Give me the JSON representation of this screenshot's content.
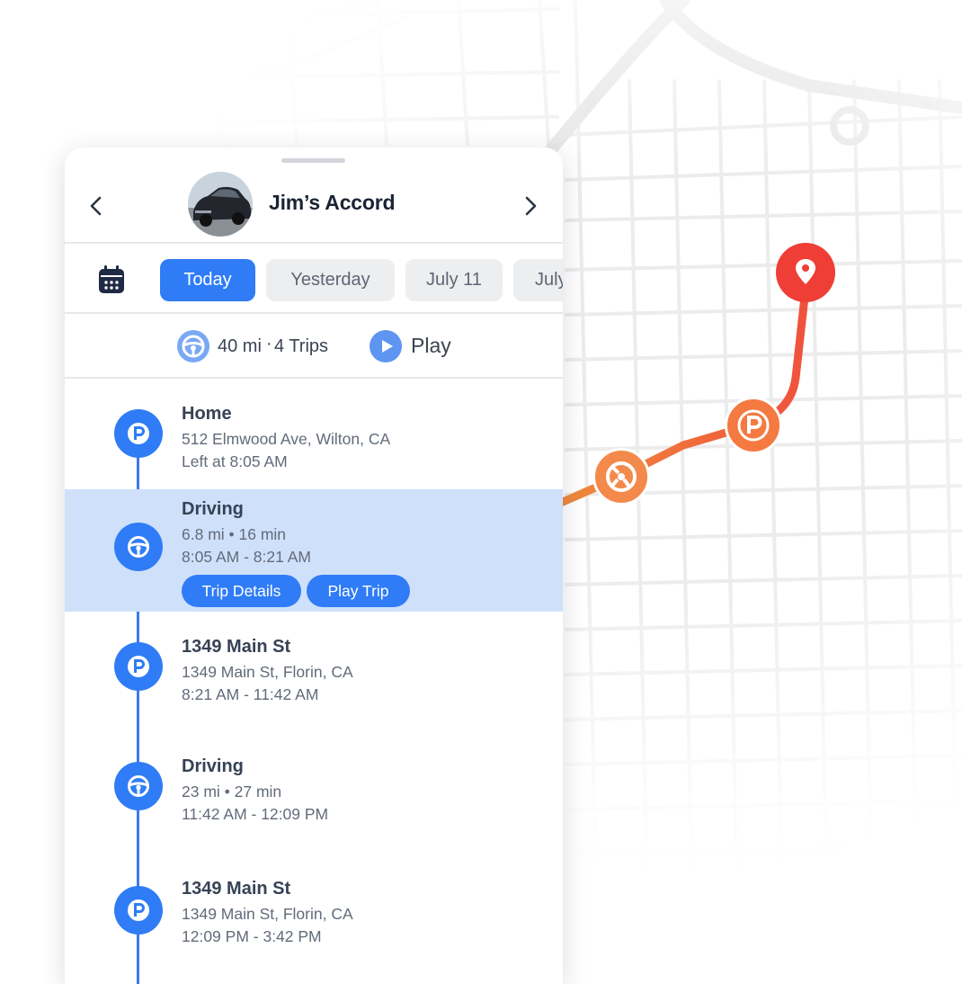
{
  "header": {
    "title": "Jim’s Accord",
    "back_icon": "chevron-left-icon",
    "forward_icon": "chevron-right-icon"
  },
  "date_tabs": [
    {
      "label": "Today",
      "active": true
    },
    {
      "label": "Yesterday",
      "active": false
    },
    {
      "label": "July 11",
      "active": false
    },
    {
      "label": "July",
      "active": false
    }
  ],
  "summary": {
    "distance": "40 mi",
    "separator": "·",
    "trips": "4 Trips",
    "play_label": "Play"
  },
  "timeline": [
    {
      "type": "parked",
      "icon": "parking-icon",
      "title": "Home",
      "line1": "512 Elmwood Ave, Wilton, CA",
      "line2": "Left at 8:05 AM"
    },
    {
      "type": "driving",
      "icon": "steering-wheel-icon",
      "title": "Driving",
      "line1": "6.8 mi  •  16 min",
      "line2": "8:05 AM -  8:21 AM",
      "selected": true,
      "actions": {
        "details": "Trip Details",
        "play": "Play Trip"
      }
    },
    {
      "type": "parked",
      "icon": "parking-icon",
      "title": "1349 Main St",
      "line1": "1349 Main St, Florin, CA",
      "line2": "8:21 AM -  11:42 AM"
    },
    {
      "type": "driving",
      "icon": "steering-wheel-icon",
      "title": "Driving",
      "line1": "23 mi  •  27 min",
      "line2": "11:42 AM - 12:09 PM"
    },
    {
      "type": "parked",
      "icon": "parking-icon",
      "title": "1349 Main St",
      "line1": "1349 Main St, Florin, CA",
      "line2": "12:09 PM -  3:42 PM"
    }
  ],
  "map": {
    "route_colors": [
      "#f08a3c",
      "#f2513b"
    ],
    "markers": [
      "steering-wheel-icon",
      "parking-icon",
      "location-pin-icon"
    ]
  },
  "colors": {
    "accent": "#2f7cf6",
    "highlight": "#cfe0fb",
    "route_start": "#f08a3c",
    "route_end": "#ef3e36"
  }
}
